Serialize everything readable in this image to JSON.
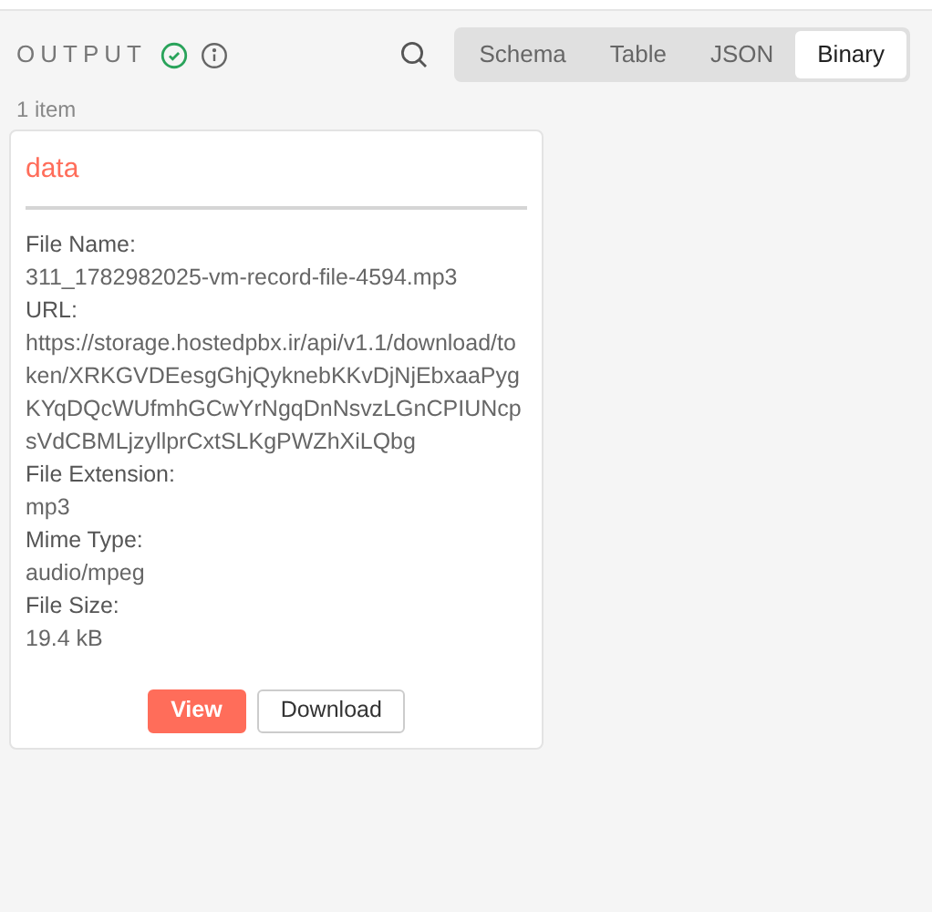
{
  "header": {
    "title": "OUTPUT",
    "success": true
  },
  "tabs": [
    {
      "label": "Schema",
      "selected": false
    },
    {
      "label": "Table",
      "selected": false
    },
    {
      "label": "JSON",
      "selected": false
    },
    {
      "label": "Binary",
      "selected": true
    }
  ],
  "item_count": "1 item",
  "card": {
    "title": "data",
    "fields": [
      {
        "label": "File Name:",
        "value": "311_1782982025-vm-record-file-4594.mp3"
      },
      {
        "label": "URL:",
        "value": "https://storage.hostedpbx.ir/api/v1.1/download/token/XRKGVDEesgGhjQyknebKKvDjNjEbxaaPygKYqDQcWUfmhGCwYrNgqDnNsvzLGnCPIUNcpsVdCBMLjzyllprCxtSLKgPWZhXiLQbg"
      },
      {
        "label": "File Extension:",
        "value": "mp3"
      },
      {
        "label": "Mime Type:",
        "value": "audio/mpeg"
      },
      {
        "label": "File Size:",
        "value": "19.4 kB"
      }
    ],
    "buttons": [
      {
        "label": "View",
        "kind": "primary"
      },
      {
        "label": "Download",
        "kind": "secondary"
      }
    ]
  }
}
